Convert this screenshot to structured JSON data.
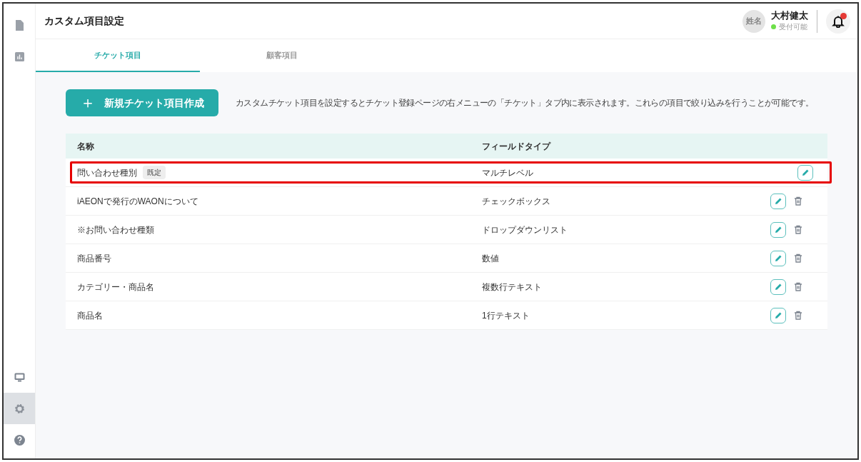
{
  "page_title": "カスタム項目設定",
  "user": {
    "avatar_text": "姓名",
    "name": "大村健太",
    "status": "受付可能",
    "available": true
  },
  "notifications": {
    "unread": true
  },
  "sidebar": {
    "top_items": [
      {
        "kind": "document",
        "selected": false
      },
      {
        "kind": "chart",
        "selected": false
      }
    ],
    "bottom_items": [
      {
        "kind": "monitor",
        "selected": false
      },
      {
        "kind": "settings",
        "selected": true
      },
      {
        "kind": "help",
        "selected": false
      }
    ]
  },
  "tabs": [
    {
      "label": "チケット項目",
      "selected": true
    },
    {
      "label": "顧客項目",
      "selected": false
    }
  ],
  "create_button": {
    "icon": "＋",
    "label": "新規チケット項目作成"
  },
  "description": "カスタムチケット項目を設定するとチケット登録ページの右メニューの「チケット」タブ内に表示されます。これらの項目で絞り込みを行うことが可能です。",
  "table": {
    "columns": [
      "名称",
      "フィールドタイプ"
    ],
    "rows": [
      {
        "name": "問い合わせ種別",
        "badge": "既定",
        "field_type": "マルチレベル",
        "deletable": false,
        "highlighted": true
      },
      {
        "name": "iAEONで発行のWAONについて",
        "field_type": "チェックボックス",
        "deletable": true,
        "highlighted": false
      },
      {
        "name": "※お問い合わせ種類",
        "field_type": "ドロップダウンリスト",
        "deletable": true,
        "highlighted": false
      },
      {
        "name": "商品番号",
        "field_type": "数値",
        "deletable": true,
        "highlighted": false
      },
      {
        "name": "カテゴリー・商品名",
        "field_type": "複数行テキスト",
        "deletable": true,
        "highlighted": false
      },
      {
        "name": "商品名",
        "field_type": "1行テキスト",
        "deletable": true,
        "highlighted": false
      }
    ]
  }
}
